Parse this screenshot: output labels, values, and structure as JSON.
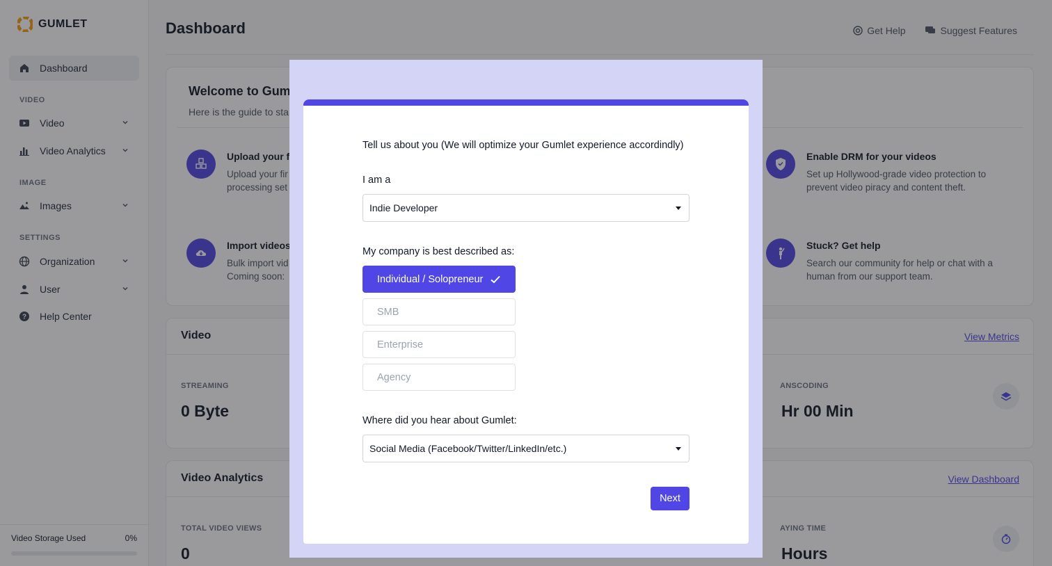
{
  "app": {
    "brand": "GUMLET"
  },
  "sidebar": {
    "dashboard": "Dashboard",
    "sections": {
      "video": "VIDEO",
      "image": "IMAGE",
      "settings": "SETTINGS"
    },
    "items": {
      "video": "Video",
      "video_analytics": "Video Analytics",
      "images": "Images",
      "organization": "Organization",
      "user": "User",
      "help_center": "Help Center"
    },
    "storage": {
      "label": "Video Storage Used",
      "value": "0%",
      "fraction": 0
    }
  },
  "header": {
    "title": "Dashboard",
    "get_help": "Get Help",
    "suggest": "Suggest Features"
  },
  "welcome": {
    "title": "Welcome to Gumlet",
    "subtitle": "Here is the guide to start",
    "features": {
      "upload": {
        "title": "Upload your f",
        "desc1": "Upload your fir",
        "desc2": "processing set"
      },
      "import": {
        "title": "Import videos",
        "desc1": "Bulk import vid",
        "desc2": "Coming soon:"
      },
      "drm": {
        "title": "Enable DRM for your videos",
        "desc1": "Set up Hollywood-grade video protection to",
        "desc2": "prevent video piracy and content theft."
      },
      "help": {
        "title": "Stuck? Get help",
        "desc1": "Search our community for help or chat with a",
        "desc2": "human from our support team."
      }
    }
  },
  "video_card": {
    "title": "Video",
    "link": "View Metrics",
    "streaming_label": "STREAMING",
    "streaming_value": "0 Byte",
    "transcoding_label": "ANSCODING",
    "transcoding_value": "Hr 00 Min"
  },
  "analytics_card": {
    "title": "Video Analytics",
    "link": "View Dashboard",
    "views_label": "TOTAL VIDEO VIEWS",
    "views_value": "0",
    "playtime_label": "AYING TIME",
    "playtime_value": "Hours"
  },
  "modal": {
    "intro": "Tell us about you (We will optimize your Gumlet experience accordindly)",
    "i_am_label": "I am a",
    "i_am_value": "Indie Developer",
    "company_label": "My company is best described as:",
    "company_options": [
      "Individual / Solopreneur",
      "SMB",
      "Enterprise",
      "Agency"
    ],
    "company_selected": 0,
    "hear_label": "Where did you hear about Gumlet:",
    "hear_value": "Social Media (Facebook/Twitter/LinkedIn/etc.)",
    "next": "Next"
  },
  "colors": {
    "accent": "#4f46e5",
    "modal_frame": "#d4d4f7"
  }
}
